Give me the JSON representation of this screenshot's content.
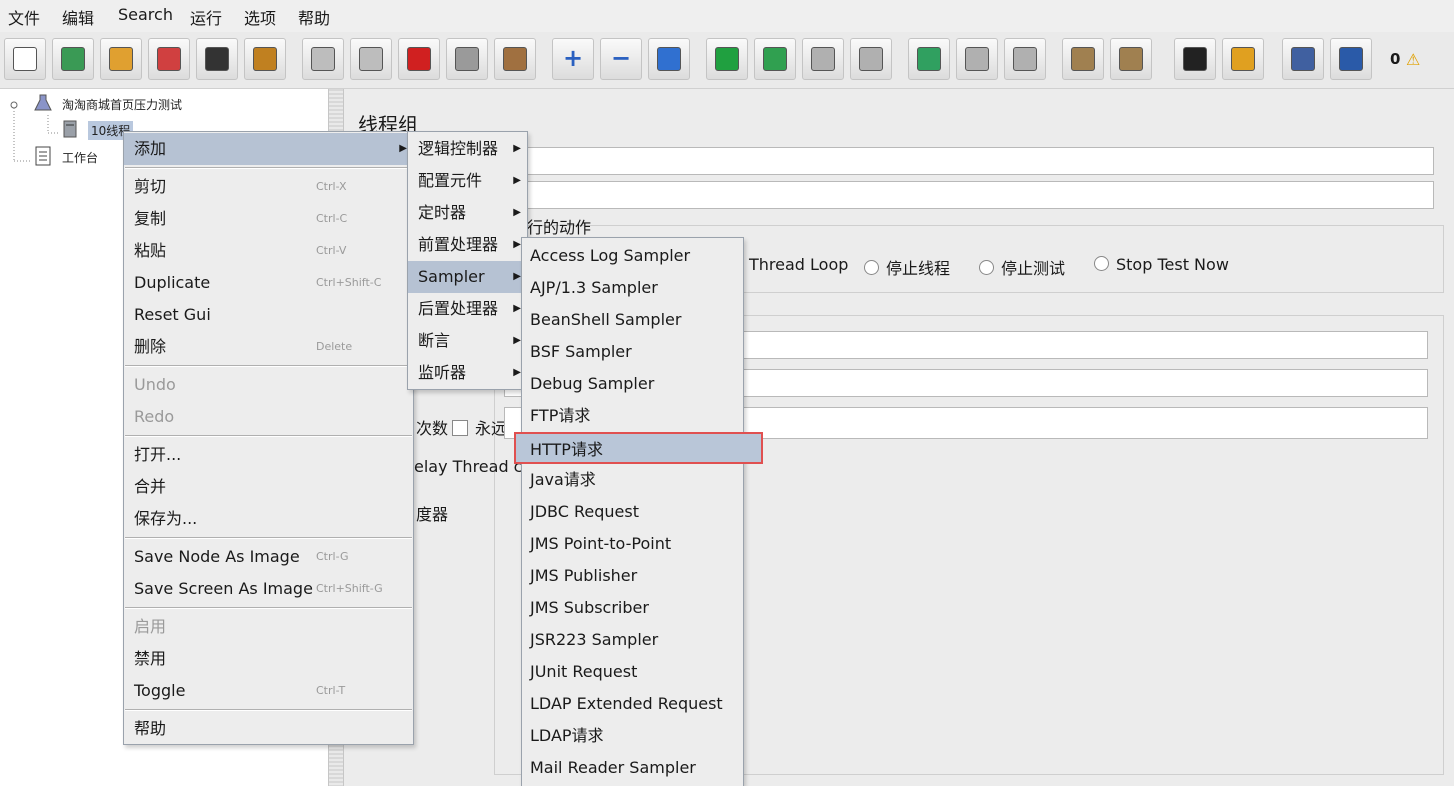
{
  "menubar": [
    "文件",
    "编辑",
    "Search",
    "运行",
    "选项",
    "帮助"
  ],
  "toolbar": {
    "buttons": [
      {
        "name": "new-icon",
        "color": "#ffffff"
      },
      {
        "name": "templates-icon",
        "color": "#3a9a55"
      },
      {
        "name": "open-icon",
        "color": "#e0a030"
      },
      {
        "name": "close-icon",
        "color": "#d04040"
      },
      {
        "name": "save-icon",
        "color": "#333333"
      },
      {
        "name": "save-as-icon",
        "color": "#c08020"
      },
      {
        "name": "undo-icon",
        "color": "#bdbdbd"
      },
      {
        "name": "redo-icon",
        "color": "#bdbdbd"
      },
      {
        "name": "cut-icon",
        "color": "#d02020"
      },
      {
        "name": "copy-icon",
        "color": "#9a9a9a"
      },
      {
        "name": "paste-icon",
        "color": "#a07040"
      },
      {
        "name": "expand-icon",
        "color": "#2a60c0",
        "glyph": "+"
      },
      {
        "name": "collapse-icon",
        "color": "#2a60c0",
        "glyph": "−"
      },
      {
        "name": "toggle-icon",
        "color": "#3070d0"
      },
      {
        "name": "start-icon",
        "color": "#20a040"
      },
      {
        "name": "start-no-pause-icon",
        "color": "#30a050"
      },
      {
        "name": "stop-icon",
        "color": "#b0b0b0"
      },
      {
        "name": "shutdown-icon",
        "color": "#b0b0b0"
      },
      {
        "name": "remote-start-icon",
        "color": "#30a060"
      },
      {
        "name": "remote-stop-icon",
        "color": "#b0b0b0"
      },
      {
        "name": "remote-shutdown-icon",
        "color": "#b0b0b0"
      },
      {
        "name": "clear-icon",
        "color": "#a08050"
      },
      {
        "name": "clear-all-icon",
        "color": "#a08050"
      },
      {
        "name": "search-icon",
        "color": "#222222"
      },
      {
        "name": "reset-search-icon",
        "color": "#e0a020"
      },
      {
        "name": "function-helper-icon",
        "color": "#4060a0"
      },
      {
        "name": "help-icon",
        "color": "#2a5aa8"
      }
    ],
    "warning_count": "0"
  },
  "tree": {
    "root": "淘淘商城首页压力测试",
    "thread_group": "10线程",
    "workbench": "工作台"
  },
  "panel": {
    "title": "线程组",
    "action_fragment": "行的动作",
    "radios": [
      "Thread Loop",
      "停止线程",
      "停止测试",
      "Stop Test Now"
    ],
    "loop_label": "次数",
    "forever": "永远",
    "delay": "elay Thread cr",
    "scheduler": "度器"
  },
  "context_menu": [
    {
      "label": "添加",
      "submenu": true,
      "selected": true
    },
    {
      "sep": true
    },
    {
      "label": "剪切",
      "shortcut": "Ctrl-X"
    },
    {
      "label": "复制",
      "shortcut": "Ctrl-C"
    },
    {
      "label": "粘贴",
      "shortcut": "Ctrl-V"
    },
    {
      "label": "Duplicate",
      "shortcut": "Ctrl+Shift-C"
    },
    {
      "label": "Reset Gui"
    },
    {
      "label": "删除",
      "shortcut": "Delete"
    },
    {
      "sep": true
    },
    {
      "label": "Undo",
      "disabled": true
    },
    {
      "label": "Redo",
      "disabled": true
    },
    {
      "sep": true
    },
    {
      "label": "打开..."
    },
    {
      "label": "合并"
    },
    {
      "label": "保存为..."
    },
    {
      "sep": true
    },
    {
      "label": "Save Node As Image",
      "shortcut": "Ctrl-G"
    },
    {
      "label": "Save Screen As Image",
      "shortcut": "Ctrl+Shift-G"
    },
    {
      "sep": true
    },
    {
      "label": "启用",
      "disabled": true
    },
    {
      "label": "禁用"
    },
    {
      "label": "Toggle",
      "shortcut": "Ctrl-T"
    },
    {
      "sep": true
    },
    {
      "label": "帮助"
    }
  ],
  "add_menu": [
    {
      "label": "逻辑控制器"
    },
    {
      "label": "配置元件"
    },
    {
      "label": "定时器"
    },
    {
      "label": "前置处理器"
    },
    {
      "label": "Sampler",
      "selected": true
    },
    {
      "label": "后置处理器"
    },
    {
      "label": "断言"
    },
    {
      "label": "监听器"
    }
  ],
  "sampler_menu": [
    {
      "label": "Access Log Sampler"
    },
    {
      "label": "AJP/1.3 Sampler"
    },
    {
      "label": "BeanShell Sampler"
    },
    {
      "label": "BSF Sampler"
    },
    {
      "label": "Debug Sampler"
    },
    {
      "label": "FTP请求"
    },
    {
      "label": "HTTP请求",
      "selected": true
    },
    {
      "label": "Java请求"
    },
    {
      "label": "JDBC Request"
    },
    {
      "label": "JMS Point-to-Point"
    },
    {
      "label": "JMS Publisher"
    },
    {
      "label": "JMS Subscriber"
    },
    {
      "label": "JSR223 Sampler"
    },
    {
      "label": "JUnit Request"
    },
    {
      "label": "LDAP Extended Request"
    },
    {
      "label": "LDAP请求"
    },
    {
      "label": "Mail Reader Sampler"
    }
  ]
}
